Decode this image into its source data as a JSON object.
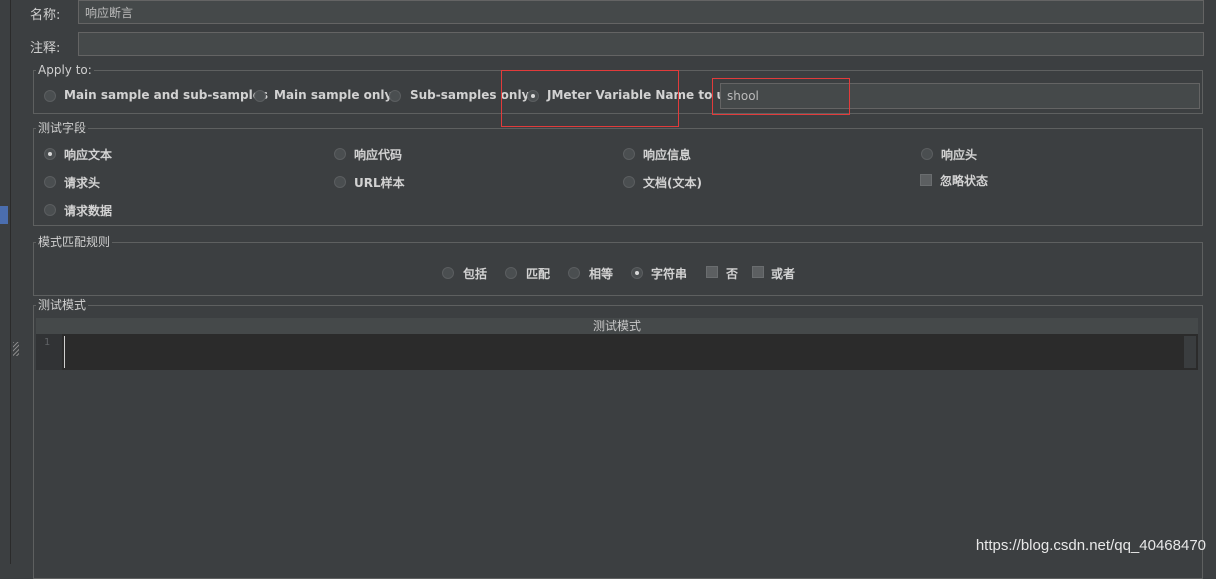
{
  "form": {
    "name_label": "名称:",
    "name_value": "响应断言",
    "comment_label": "注释:",
    "comment_value": ""
  },
  "apply_to": {
    "legend": "Apply to:",
    "options": [
      "Main sample and sub-samples",
      "Main sample only",
      "Sub-samples only",
      "JMeter Variable Name to use"
    ],
    "selected": "JMeter Variable Name to use",
    "variable_value": "shool"
  },
  "test_field": {
    "legend": "测试字段",
    "options": [
      "响应文本",
      "响应代码",
      "响应信息",
      "响应头",
      "请求头",
      "URL样本",
      "文档(文本)",
      "请求数据"
    ],
    "selected": "响应文本",
    "ignore_status_label": "忽略状态",
    "ignore_status_checked": false
  },
  "pattern_rules": {
    "legend": "模式匹配规则",
    "options": [
      "包括",
      "匹配",
      "相等",
      "字符串"
    ],
    "selected": "字符串",
    "checks": [
      "否",
      "或者"
    ]
  },
  "test_patterns": {
    "legend": "测试模式",
    "column_header": "测试模式",
    "line_number": "1"
  },
  "watermark": "https://blog.csdn.net/qq_40468470",
  "colors": {
    "background": "#3c3f41",
    "highlight_box": "#e23b3b",
    "editor_bg": "#2b2b2b"
  }
}
